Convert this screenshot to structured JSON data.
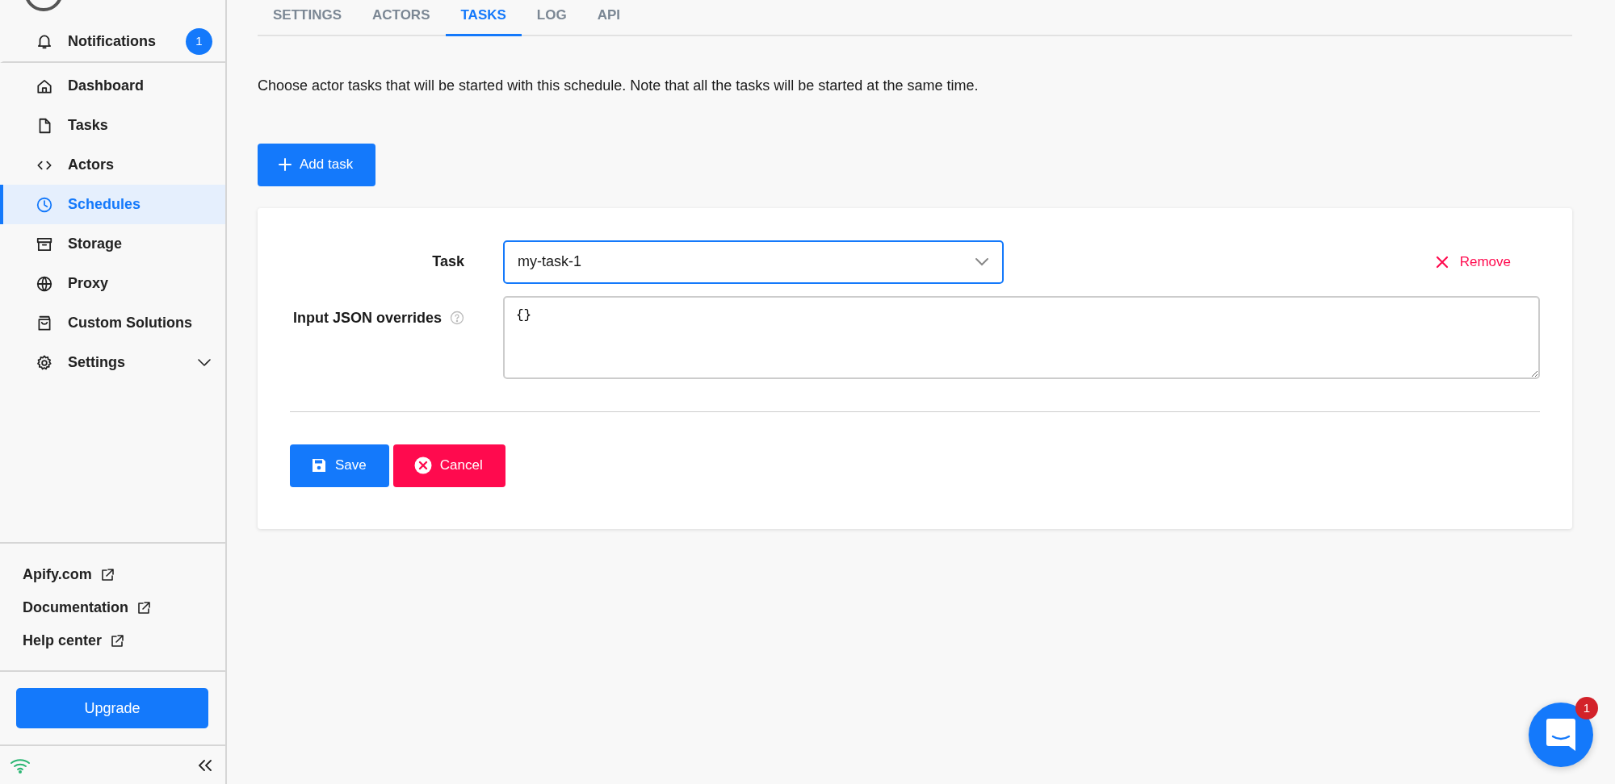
{
  "sidebar": {
    "notifications": {
      "label": "Notifications",
      "count": "1"
    },
    "nav_items": [
      {
        "label": "Dashboard",
        "selected": false,
        "expandable": false
      },
      {
        "label": "Tasks",
        "selected": false,
        "expandable": false
      },
      {
        "label": "Actors",
        "selected": false,
        "expandable": false
      },
      {
        "label": "Schedules",
        "selected": true,
        "expandable": false
      },
      {
        "label": "Storage",
        "selected": false,
        "expandable": false
      },
      {
        "label": "Proxy",
        "selected": false,
        "expandable": false
      },
      {
        "label": "Custom Solutions",
        "selected": false,
        "expandable": false
      },
      {
        "label": "Settings",
        "selected": false,
        "expandable": true
      }
    ],
    "links": [
      {
        "label": "Apify.com"
      },
      {
        "label": "Documentation"
      },
      {
        "label": "Help center"
      }
    ],
    "upgrade_button": "Upgrade"
  },
  "tabs": [
    {
      "label": "SETTINGS",
      "selected": false
    },
    {
      "label": "ACTORS",
      "selected": false
    },
    {
      "label": "TASKS",
      "selected": true
    },
    {
      "label": "LOG",
      "selected": false
    },
    {
      "label": "API",
      "selected": false
    }
  ],
  "description": "Choose actor tasks that will be started with this schedule. Note that all the tasks will be started at the same time.",
  "add_task_button": "Add task",
  "task_form": {
    "task_label": "Task",
    "task_value": "my-task-1",
    "remove_button": "Remove",
    "input_label": "Input JSON overrides",
    "input_value": "{}",
    "save_button": "Save",
    "cancel_button": "Cancel"
  },
  "chat": {
    "badge": "1"
  }
}
